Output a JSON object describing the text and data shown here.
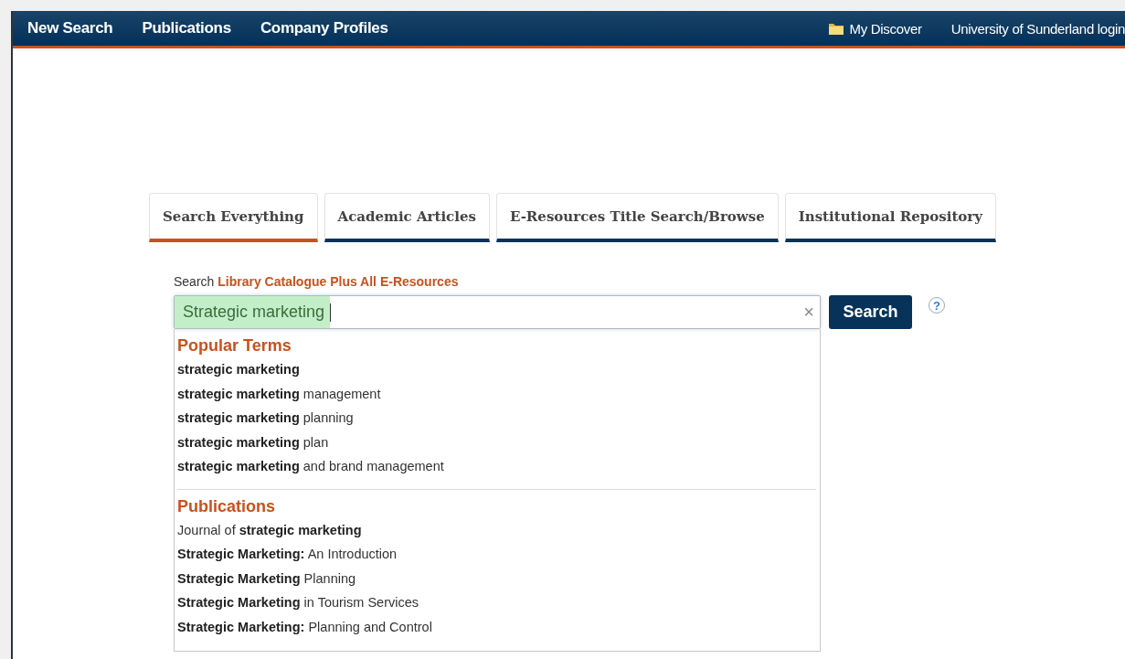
{
  "nav": {
    "left": [
      "New Search",
      "Publications",
      "Company Profiles"
    ],
    "my_discover": "My Discover",
    "login": "University of Sunderland login"
  },
  "tabs": [
    {
      "label": "Search Everything",
      "selected": true
    },
    {
      "label": "Academic Articles",
      "selected": false
    },
    {
      "label": "E-Resources Title Search/Browse",
      "selected": false
    },
    {
      "label": "Institutional Repository",
      "selected": false
    }
  ],
  "search": {
    "prefix": "Search",
    "scope": "Library Catalogue Plus All E-Resources",
    "value": "Strategic marketing",
    "clear": "×",
    "button": "Search",
    "help": "?"
  },
  "suggestions": [
    {
      "heading": "Popular Terms",
      "items": [
        "**strategic marketing**",
        "**strategic marketing** management",
        "**strategic marketing** planning",
        "**strategic marketing** plan",
        "**strategic marketing** and brand management"
      ]
    },
    {
      "heading": "Publications",
      "items": [
        "Journal of **strategic marketing**",
        "**Strategic Marketing:** An Introduction",
        "**Strategic Marketing** Planning",
        "**Strategic Marketing** in Tourism Services",
        "**Strategic Marketing:** Planning and Control"
      ]
    }
  ]
}
